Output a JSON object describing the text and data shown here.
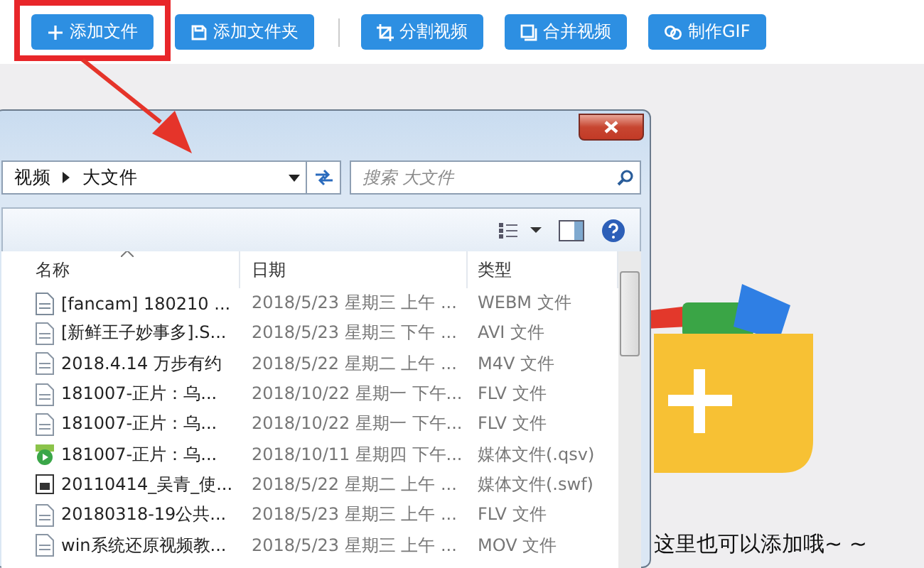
{
  "toolbar": {
    "buttons": [
      {
        "label": "添加文件",
        "kind": "plus",
        "highlighted": true
      },
      {
        "label": "添加文件夹",
        "kind": "folder"
      },
      {
        "label": "分割视频",
        "kind": "crop"
      },
      {
        "label": "合并视频",
        "kind": "merge"
      },
      {
        "label": "制作GIF",
        "kind": "link"
      }
    ]
  },
  "dialog": {
    "breadcrumb": [
      "视频",
      "大文件"
    ],
    "search": {
      "placeholder": "搜索 大文件"
    },
    "columns": [
      {
        "label": "名称",
        "sorted": true
      },
      {
        "label": "日期",
        "sorted": false
      },
      {
        "label": "类型",
        "sorted": false
      }
    ],
    "rows": [
      {
        "kind": "video",
        "name": "[fancam] 180210 ...",
        "date": "2018/5/23 星期三 上午 ...",
        "type": "WEBM 文件"
      },
      {
        "kind": "avi",
        "name": "[新鲜王子妙事多].S...",
        "date": "2018/5/23 星期三 下午 ...",
        "type": "AVI 文件"
      },
      {
        "kind": "mp4",
        "name": "2018.4.14 万步有约",
        "date": "2018/5/22 星期二 上午 ...",
        "type": "M4V 文件"
      },
      {
        "kind": "flv",
        "name": "181007-正片：乌...",
        "date": "2018/10/22 星期一 下午...",
        "type": "FLV 文件"
      },
      {
        "kind": "flv",
        "name": "181007-正片：乌...",
        "date": "2018/10/22 星期一 下午...",
        "type": "FLV 文件"
      },
      {
        "kind": "qsv",
        "name": "181007-正片：乌...",
        "date": "2018/10/11 星期四 下午...",
        "type": "媒体文件(.qsv)"
      },
      {
        "kind": "swf",
        "name": "20110414_吴青_使...",
        "date": "2018/5/22 星期二 上午 ...",
        "type": "媒体文件(.swf)"
      },
      {
        "kind": "flv",
        "name": "20180318-19公共...",
        "date": "2018/5/23 星期三 上午 ...",
        "type": "FLV 文件"
      },
      {
        "kind": "mov",
        "name": "win系统还原视频教...",
        "date": "2018/5/23 星期三 上午 ...",
        "type": "MOV 文件"
      }
    ]
  },
  "hint": "这里也可以添加哦~ ~"
}
